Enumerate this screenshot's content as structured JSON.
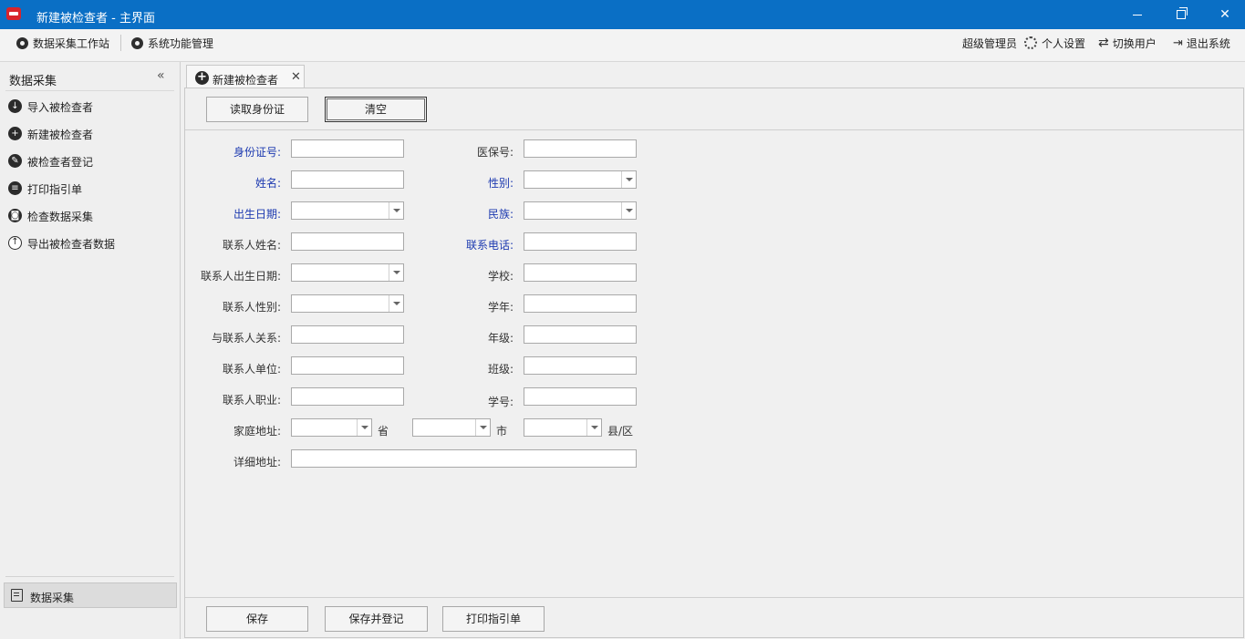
{
  "window": {
    "title": "新建被检查者 - 主界面"
  },
  "menubar": {
    "left_items": [
      {
        "label": "数据采集工作站",
        "icon": "workstation-icon"
      },
      {
        "label": "系统功能管理",
        "icon": "system-icon"
      }
    ],
    "user_label": "超级管理员",
    "right_items": [
      {
        "label": "个人设置",
        "icon": "gear-icon"
      },
      {
        "label": "切换用户",
        "icon": "switch-user-icon"
      },
      {
        "label": "退出系统",
        "icon": "logout-icon"
      }
    ]
  },
  "sidebar": {
    "title": "数据采集",
    "collapse_glyph": "«",
    "items": [
      {
        "label": "导入被检查者",
        "icon": "import-icon"
      },
      {
        "label": "新建被检查者",
        "icon": "add-icon"
      },
      {
        "label": "被检查者登记",
        "icon": "edit-icon"
      },
      {
        "label": "打印指引单",
        "icon": "print-icon"
      },
      {
        "label": "检查数据采集",
        "icon": "camera-icon"
      },
      {
        "label": "导出被检查者数据",
        "icon": "export-icon"
      }
    ],
    "bottom_item": {
      "label": "数据采集",
      "icon": "document-icon"
    }
  },
  "tab": {
    "label": "新建被检查者",
    "close_glyph": "✕"
  },
  "top_buttons": {
    "read_id": "读取身份证",
    "clear": "清空"
  },
  "form": {
    "id_number": {
      "label": "身份证号:",
      "value": ""
    },
    "insurance_number": {
      "label": "医保号:",
      "value": ""
    },
    "name": {
      "label": "姓名:",
      "value": ""
    },
    "gender": {
      "label": "性别:",
      "value": ""
    },
    "birth_date": {
      "label": "出生日期:",
      "value": ""
    },
    "ethnicity": {
      "label": "民族:",
      "value": ""
    },
    "contact_name": {
      "label": "联系人姓名:",
      "value": ""
    },
    "contact_phone": {
      "label": "联系电话:",
      "value": ""
    },
    "contact_birth_date": {
      "label": "联系人出生日期:",
      "value": ""
    },
    "school": {
      "label": "学校:",
      "value": ""
    },
    "contact_gender": {
      "label": "联系人性别:",
      "value": ""
    },
    "school_year": {
      "label": "学年:",
      "value": ""
    },
    "relationship": {
      "label": "与联系人关系:",
      "value": ""
    },
    "grade": {
      "label": "年级:",
      "value": ""
    },
    "contact_employer": {
      "label": "联系人单位:",
      "value": ""
    },
    "class": {
      "label": "班级:",
      "value": ""
    },
    "contact_occupation": {
      "label": "联系人职业:",
      "value": ""
    },
    "student_number": {
      "label": "学号:",
      "value": ""
    },
    "home_address": {
      "label": "家庭地址:",
      "province_unit": "省",
      "city_unit": "市",
      "county_unit": "县/区"
    },
    "detail_address": {
      "label": "详细地址:",
      "value": ""
    }
  },
  "bottom_buttons": {
    "save": "保存",
    "save_and_register": "保存并登记",
    "print_guide": "打印指引单"
  },
  "colors": {
    "titlebar": "#0a6fc5",
    "required_label": "#1d3ab0"
  }
}
